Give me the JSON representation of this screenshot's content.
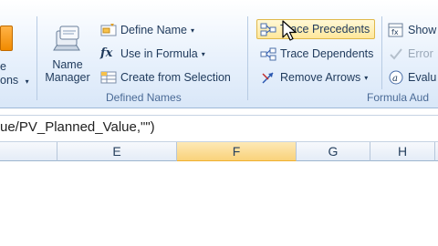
{
  "ribbon": {
    "left_partial": {
      "line1": "e",
      "line2": "ons",
      "caret": "▾"
    },
    "defined_names": {
      "name_manager": {
        "line1": "Name",
        "line2": "Manager"
      },
      "define_name": "Define Name",
      "use_in_formula": "Use in Formula",
      "create_from_selection": "Create from Selection",
      "group_label": "Defined Names"
    },
    "formula_auditing": {
      "trace_precedents": "Trace Precedents",
      "trace_dependents": "Trace Dependents",
      "remove_arrows": "Remove Arrows",
      "show_formulas": "Show",
      "error_checking": "Error",
      "evaluate_formula": "Evalu",
      "group_label": "Formula Aud"
    }
  },
  "formula_bar": {
    "text": "ue/PV_Planned_Value,\"\")"
  },
  "columns": [
    {
      "label": "",
      "selected": false
    },
    {
      "label": "E",
      "selected": false
    },
    {
      "label": "F",
      "selected": true
    },
    {
      "label": "G",
      "selected": false
    },
    {
      "label": "H",
      "selected": false
    },
    {
      "label": "",
      "selected": false
    }
  ],
  "colors": {
    "accent": "#f0b030",
    "ribbon_text": "#1e395b",
    "group_label": "#4a6a96"
  }
}
